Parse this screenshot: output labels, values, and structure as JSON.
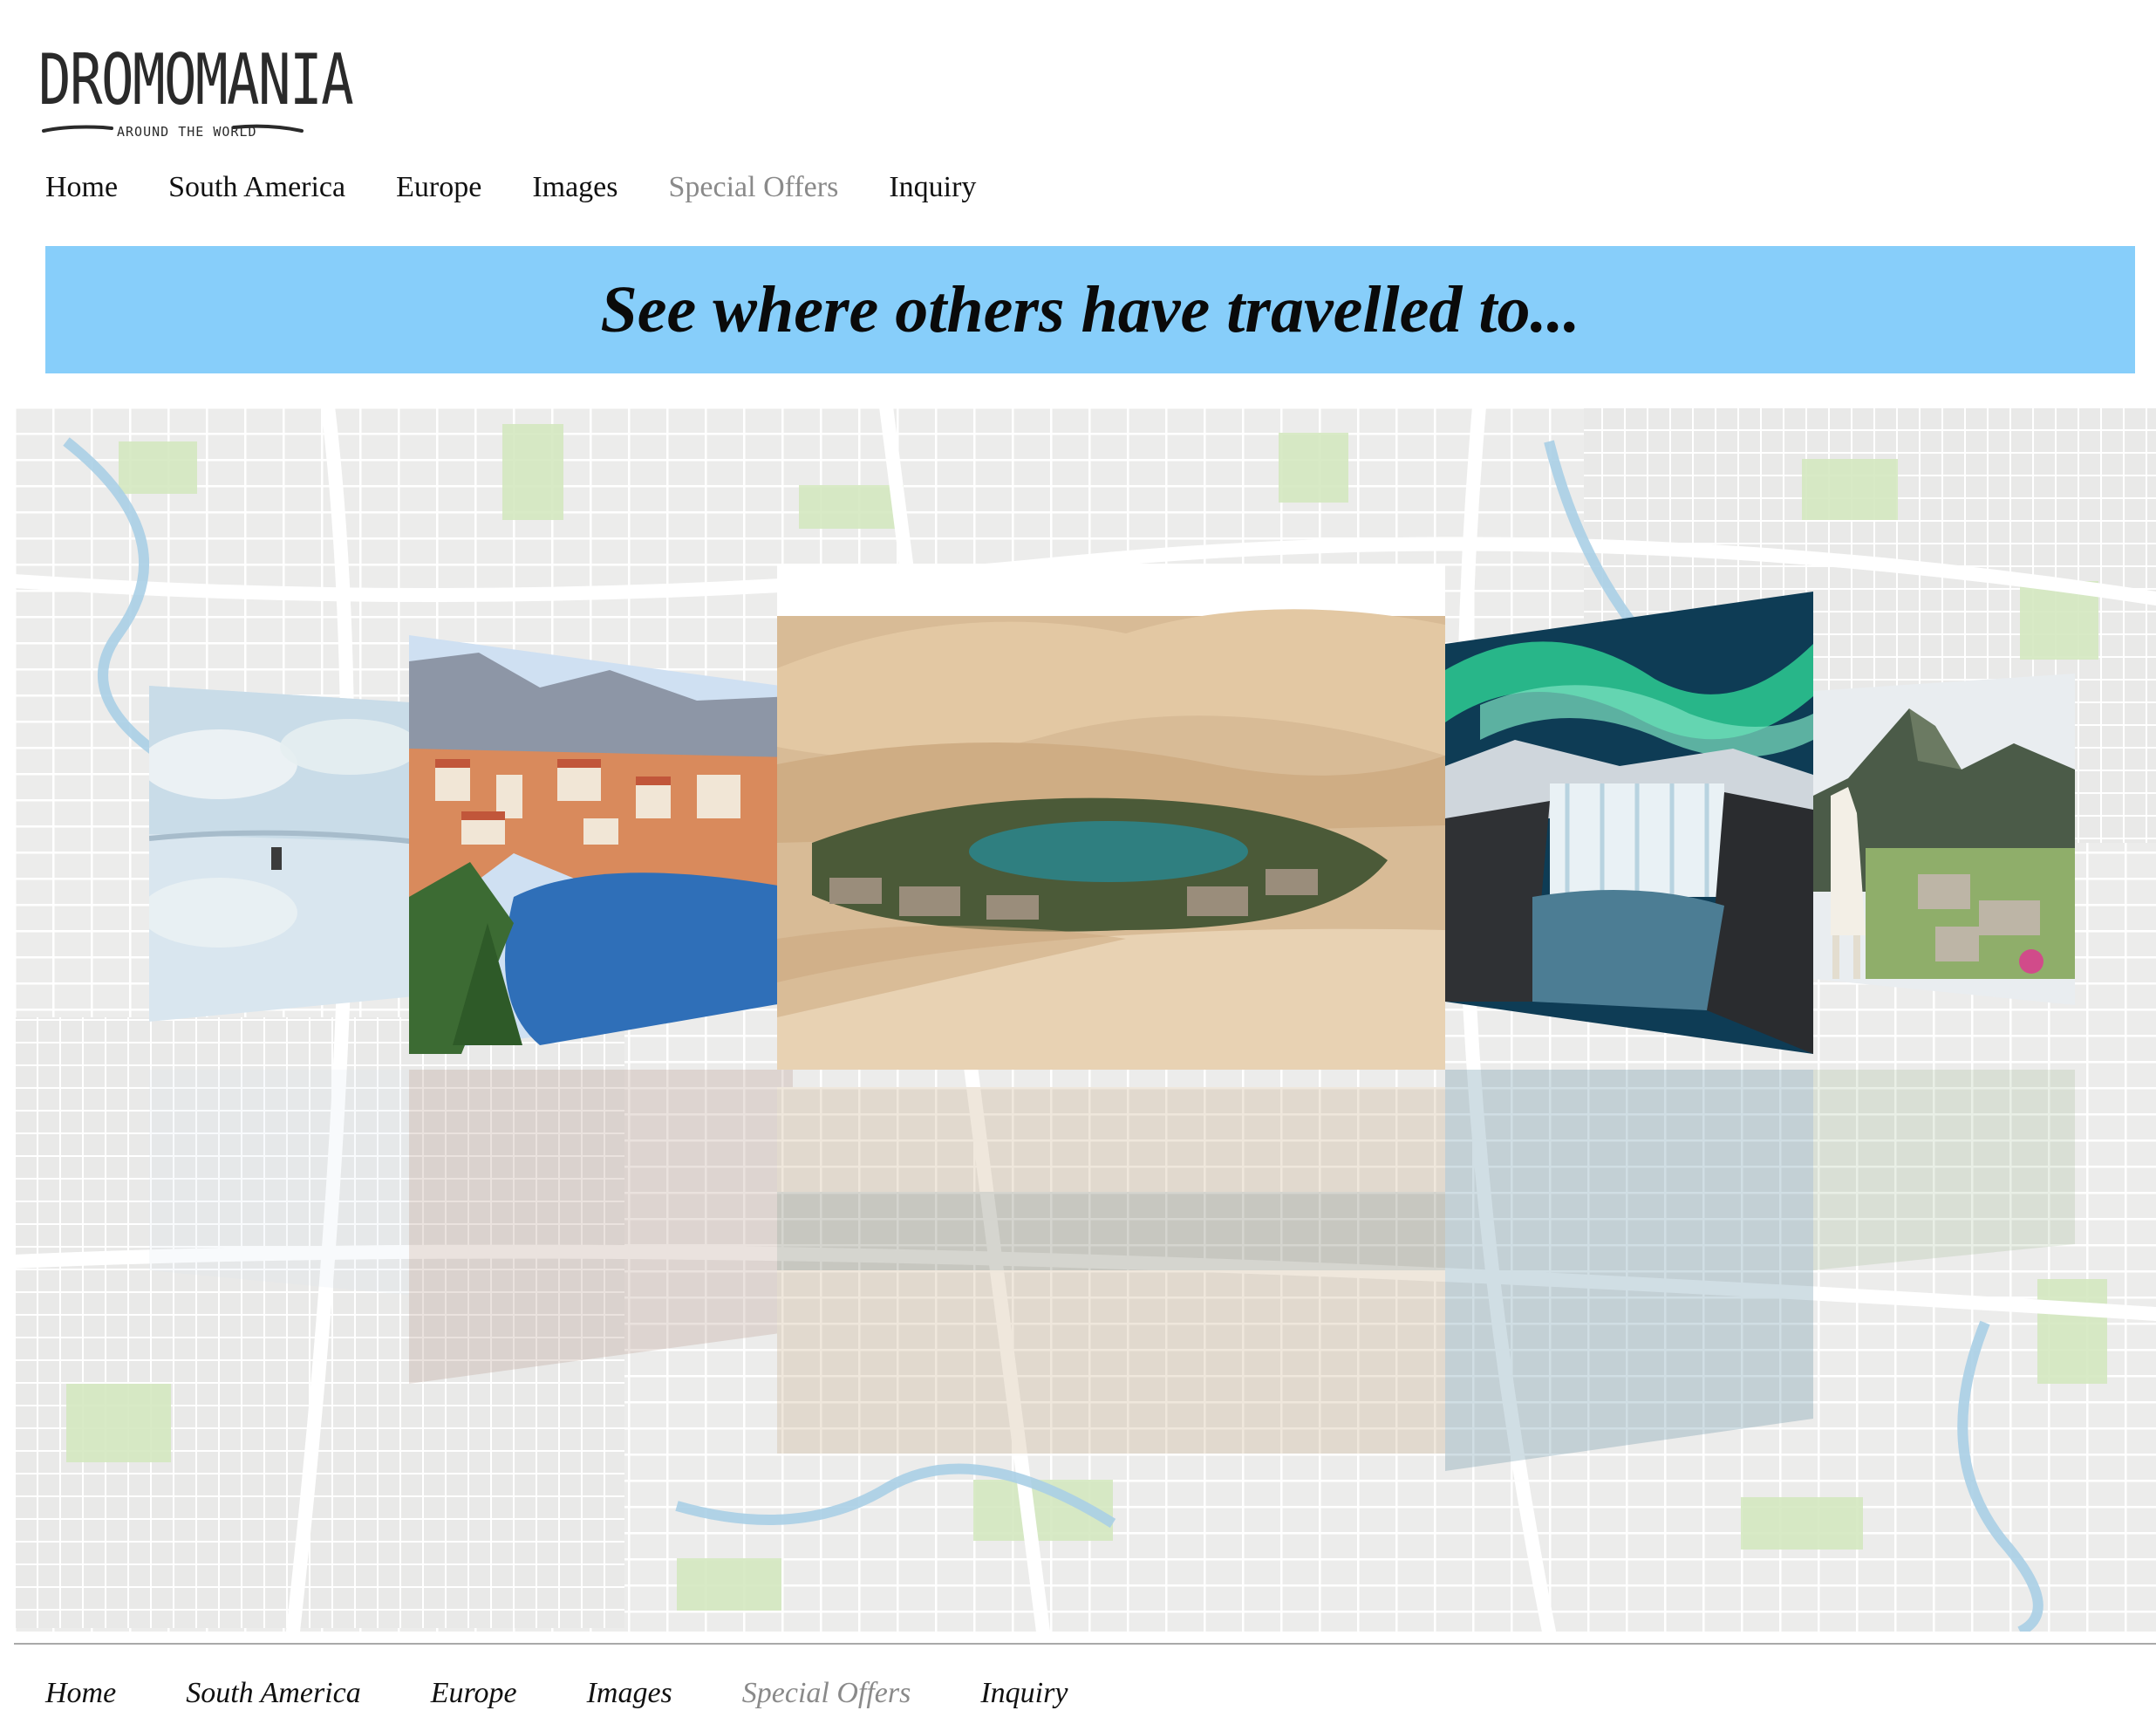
{
  "logo": {
    "name": "DROMOMANIA",
    "tagline": "AROUND THE WORLD"
  },
  "nav": [
    {
      "label": "Home",
      "active": false
    },
    {
      "label": "South America",
      "active": false
    },
    {
      "label": "Europe",
      "active": false
    },
    {
      "label": "Images",
      "active": false
    },
    {
      "label": "Special Offers",
      "active": true
    },
    {
      "label": "Inquiry",
      "active": false
    }
  ],
  "banner": {
    "title": "See where others have travelled to...",
    "color": "#87cefa"
  },
  "gallery": {
    "background": "city-map",
    "slides": [
      {
        "scene": "salt-flat-reflection-icon"
      },
      {
        "scene": "coastal-city-harbor-icon"
      },
      {
        "scene": "desert-oasis-icon"
      },
      {
        "scene": "aurora-waterfall-icon"
      },
      {
        "scene": "llama-mountain-ruins-icon"
      }
    ]
  },
  "footer_nav": [
    {
      "label": "Home"
    },
    {
      "label": "South America"
    },
    {
      "label": "Europe"
    },
    {
      "label": "Images"
    },
    {
      "label": "Special Offers"
    },
    {
      "label": "Inquiry"
    }
  ]
}
